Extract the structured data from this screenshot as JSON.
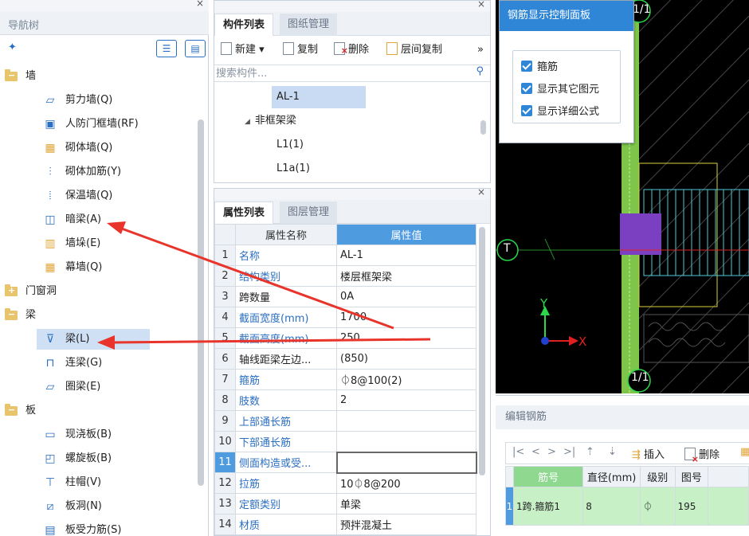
{
  "nav": {
    "title": "导航树",
    "close": "×",
    "items": [
      {
        "label": "墙",
        "icon": "folder-open-icon"
      },
      {
        "label": "剪力墙(Q)",
        "icon": "shear-wall-icon"
      },
      {
        "label": "人防门框墙(RF)",
        "icon": "door-frame-wall-icon"
      },
      {
        "label": "砌体墙(Q)",
        "icon": "masonry-wall-icon"
      },
      {
        "label": "砌体加筋(Y)",
        "icon": "masonry-rebar-icon"
      },
      {
        "label": "保温墙(Q)",
        "icon": "insulation-wall-icon"
      },
      {
        "label": "暗梁(A)",
        "icon": "hidden-beam-icon"
      },
      {
        "label": "墙垛(E)",
        "icon": "wall-pier-icon"
      },
      {
        "label": "幕墙(Q)",
        "icon": "curtain-wall-icon"
      },
      {
        "label": "门窗洞",
        "icon": "folder-closed-icon"
      },
      {
        "label": "梁",
        "icon": "folder-open-icon"
      },
      {
        "label": "梁(L)",
        "icon": "beam-icon"
      },
      {
        "label": "连梁(G)",
        "icon": "coupling-beam-icon"
      },
      {
        "label": "圈梁(E)",
        "icon": "ring-beam-icon"
      },
      {
        "label": "板",
        "icon": "folder-open-icon"
      },
      {
        "label": "现浇板(B)",
        "icon": "cast-slab-icon"
      },
      {
        "label": "螺旋板(B)",
        "icon": "spiral-slab-icon"
      },
      {
        "label": "柱帽(V)",
        "icon": "column-cap-icon"
      },
      {
        "label": "板洞(N)",
        "icon": "slab-hole-icon"
      },
      {
        "label": "板受力筋(S)",
        "icon": "slab-rebar-icon"
      }
    ]
  },
  "component_panel": {
    "close": "×",
    "tabs": [
      "构件列表",
      "图纸管理"
    ],
    "toolbar": {
      "new": "新建",
      "copy": "复制",
      "delete": "删除",
      "floor_copy": "层间复制",
      "more": "»"
    },
    "search_placeholder": "搜索构件...",
    "items": [
      {
        "label": "AL-1"
      },
      {
        "label": "非框架梁"
      },
      {
        "label": "L1(1)"
      },
      {
        "label": "L1a(1)"
      }
    ]
  },
  "property_panel": {
    "close": "×",
    "tabs": [
      "属性列表",
      "图层管理"
    ],
    "headers": {
      "name": "属性名称",
      "value": "属性值"
    },
    "rows": [
      {
        "idx": "1",
        "name": "名称",
        "value": "AL-1",
        "blue": true
      },
      {
        "idx": "2",
        "name": "结构类别",
        "value": "楼层框架梁",
        "blue": true
      },
      {
        "idx": "3",
        "name": "跨数量",
        "value": "0A",
        "blue": false
      },
      {
        "idx": "4",
        "name": "截面宽度(mm)",
        "value": "1700",
        "blue": true
      },
      {
        "idx": "5",
        "name": "截面高度(mm)",
        "value": "250",
        "blue": true
      },
      {
        "idx": "6",
        "name": "轴线距梁左边...",
        "value": "(850)",
        "blue": false
      },
      {
        "idx": "7",
        "name": "箍筋",
        "value": "⏀8@100(2)",
        "blue": true
      },
      {
        "idx": "8",
        "name": "肢数",
        "value": "2",
        "blue": true
      },
      {
        "idx": "9",
        "name": "上部通长筋",
        "value": "",
        "blue": true
      },
      {
        "idx": "10",
        "name": "下部通长筋",
        "value": "",
        "blue": true
      },
      {
        "idx": "11",
        "name": "侧面构造或受...",
        "value": "",
        "blue": true
      },
      {
        "idx": "12",
        "name": "拉筋",
        "value": "10⏀8@200",
        "blue": true
      },
      {
        "idx": "13",
        "name": "定额类别",
        "value": "单梁",
        "blue": true
      },
      {
        "idx": "14",
        "name": "材质",
        "value": "预拌混凝土",
        "blue": true
      }
    ]
  },
  "rebar_control": {
    "title": "钢筋显示控制面板",
    "options": [
      {
        "label": "箍筋",
        "checked": true
      },
      {
        "label": "显示其它图元",
        "checked": true
      },
      {
        "label": "显示详细公式",
        "checked": true
      }
    ]
  },
  "canvas": {
    "axis_top": "1/1",
    "axis_bottom": "1/1",
    "axis_left": "T",
    "y_label": "Y",
    "x_label": "X"
  },
  "edit_rebar": {
    "title": "编辑钢筋",
    "nav": [
      "|<",
      "<",
      ">",
      ">|"
    ],
    "insert": "插入",
    "delete": "删除",
    "headers": [
      "筋号",
      "直径(mm)",
      "级别",
      "图号"
    ],
    "row": {
      "idx": "1",
      "bar_no": "1跨.箍筋1",
      "diameter": "8",
      "grade": "⏀",
      "shape_no": "195"
    }
  },
  "colors": {
    "accent": "#2f86d6",
    "selected": "#cfe0f5",
    "arrow": "#e8342a"
  }
}
